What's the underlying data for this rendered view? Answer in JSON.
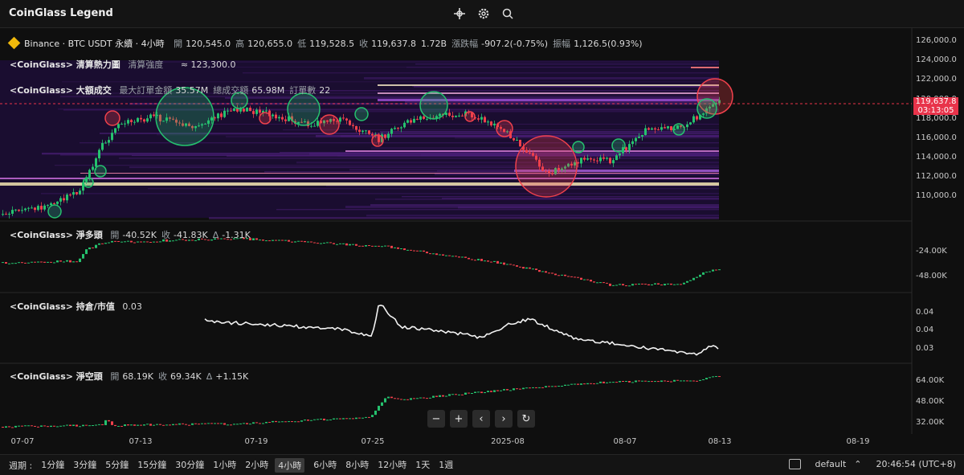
{
  "app": {
    "title": "CoinGlass Legend"
  },
  "toolbar": {
    "icons": [
      "crosshair-icon",
      "settings-icon",
      "search-icon"
    ]
  },
  "main_pane": {
    "symbol": "Binance · BTC USDT 永續 · 4小時",
    "ohlc": [
      {
        "k": "開",
        "v": "120,545.0"
      },
      {
        "k": "高",
        "v": "120,655.0"
      },
      {
        "k": "低",
        "v": "119,528.5"
      },
      {
        "k": "收",
        "v": "119,637.8"
      },
      {
        "k": "",
        "v": "1.72B"
      },
      {
        "k": "漲跌幅",
        "v": "-907.2(-0.75%)"
      },
      {
        "k": "振幅",
        "v": "1,126.5(0.93%)"
      }
    ],
    "heatmap_label": {
      "name": "<CoinGlass> 清算熱力圖",
      "k": "清算強度",
      "v": "≈ 123,300.0"
    },
    "bigtrade_label": {
      "name": "<CoinGlass> 大額成交",
      "items": [
        {
          "k": "最大訂單金額",
          "v": "35.57M"
        },
        {
          "k": "總成交額",
          "v": "65.98M"
        },
        {
          "k": "訂單數",
          "v": "22"
        }
      ]
    },
    "y_ticks": [
      "126,000.0",
      "124,000.0",
      "122,000.0",
      "120,000.0",
      "118,000.0",
      "116,000.0",
      "114,000.0",
      "112,000.0",
      "110,000.0"
    ],
    "price_tag": {
      "price": "119,637.8",
      "countdown": "03:13:05"
    }
  },
  "net_long_pane": {
    "name": "<CoinGlass> 淨多頭",
    "items": [
      {
        "k": "開",
        "v": "-40.52K"
      },
      {
        "k": "收",
        "v": "-41.83K"
      },
      {
        "k": "Δ",
        "v": "-1.31K"
      }
    ],
    "y_ticks": [
      "-24.00K",
      "-48.00K"
    ]
  },
  "oi_pane": {
    "name": "<CoinGlass> 持倉/市值",
    "value": "0.03",
    "y_ticks": [
      "0.04",
      "0.04",
      "0.03"
    ]
  },
  "net_short_pane": {
    "name": "<CoinGlass> 淨空頭",
    "items": [
      {
        "k": "開",
        "v": "68.19K"
      },
      {
        "k": "收",
        "v": "69.34K"
      },
      {
        "k": "Δ",
        "v": "+1.15K"
      }
    ],
    "y_ticks": [
      "64.00K",
      "48.00K",
      "32.00K"
    ]
  },
  "x_axis": [
    "07-07",
    "07-13",
    "07-19",
    "07-25",
    "2025-08",
    "08-07",
    "08-13",
    "08-19"
  ],
  "nav_buttons": [
    "−",
    "+",
    "‹",
    "›",
    "↻"
  ],
  "bottom_bar": {
    "period_label": "週期 :",
    "periods": [
      "1分鐘",
      "3分鐘",
      "5分鐘",
      "15分鐘",
      "30分鐘",
      "1小時",
      "2小時",
      "4小時",
      "6小時",
      "8小時",
      "12小時",
      "1天",
      "1週"
    ],
    "selected_period": "4小時",
    "theme": "default",
    "clock": "20:46:54 (UTC+8)"
  },
  "colors": {
    "up": "#25c26e",
    "down": "#f0414c",
    "price_line": "#e8334a",
    "accent_btc": "#f0b90b"
  }
}
